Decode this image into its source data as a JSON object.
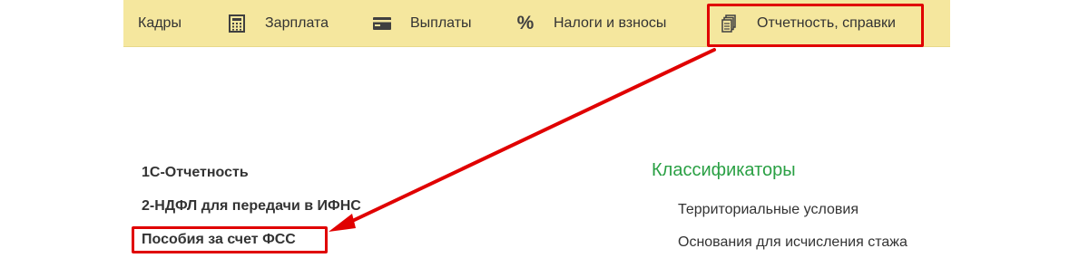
{
  "nav": {
    "items": [
      {
        "label": "Кадры",
        "icon": ""
      },
      {
        "label": "Зарплата",
        "icon": "calculator-icon"
      },
      {
        "label": "Выплаты",
        "icon": "wallet-icon"
      },
      {
        "label": "Налоги и взносы",
        "icon": "percent-icon"
      },
      {
        "label": "Отчетность, справки",
        "icon": "documents-icon"
      }
    ],
    "percent_glyph": "%"
  },
  "left_links": [
    {
      "label": "1С-Отчетность"
    },
    {
      "label": "2-НДФЛ для передачи в ИФНС"
    },
    {
      "label": "Пособия за счет ФСС"
    }
  ],
  "classifiers": {
    "title": "Классификаторы",
    "links": [
      {
        "label": "Территориальные условия"
      },
      {
        "label": "Основания для исчисления стажа"
      }
    ]
  },
  "colors": {
    "topbar": "#f5e79e",
    "highlight": "#e00000",
    "section_title": "#2aa044",
    "text": "#333333"
  }
}
